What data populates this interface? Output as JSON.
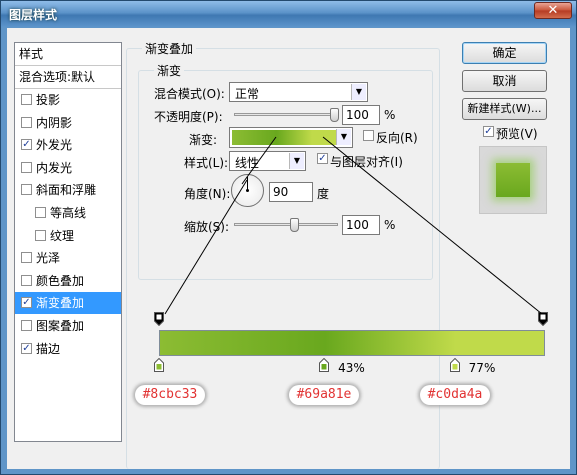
{
  "window": {
    "title": "图层样式",
    "close_glyph": "✕"
  },
  "style_list": {
    "header": "样式",
    "blend_default": "混合选项:默认",
    "items": [
      {
        "label": "投影",
        "checked": false,
        "indent": false,
        "selected": false
      },
      {
        "label": "内阴影",
        "checked": false,
        "indent": false,
        "selected": false
      },
      {
        "label": "外发光",
        "checked": true,
        "indent": false,
        "selected": false
      },
      {
        "label": "内发光",
        "checked": false,
        "indent": false,
        "selected": false
      },
      {
        "label": "斜面和浮雕",
        "checked": false,
        "indent": false,
        "selected": false
      },
      {
        "label": "等高线",
        "checked": false,
        "indent": true,
        "selected": false
      },
      {
        "label": "纹理",
        "checked": false,
        "indent": true,
        "selected": false
      },
      {
        "label": "光泽",
        "checked": false,
        "indent": false,
        "selected": false
      },
      {
        "label": "颜色叠加",
        "checked": false,
        "indent": false,
        "selected": false
      },
      {
        "label": "渐变叠加",
        "checked": true,
        "indent": false,
        "selected": true
      },
      {
        "label": "图案叠加",
        "checked": false,
        "indent": false,
        "selected": false
      },
      {
        "label": "描边",
        "checked": true,
        "indent": false,
        "selected": false
      }
    ]
  },
  "panel": {
    "section_title": "渐变叠加",
    "group_title": "渐变",
    "blend_mode_label": "混合模式(O):",
    "blend_mode_value": "正常",
    "opacity_label": "不透明度(P):",
    "opacity_value": "100",
    "opacity_unit": "%",
    "gradient_label": "渐变:",
    "reverse_label": "反向(R)",
    "reverse_checked": false,
    "style_label": "样式(L):",
    "style_value": "线性",
    "align_label": "与图层对齐(I)",
    "align_checked": true,
    "angle_label": "角度(N):",
    "angle_value": "90",
    "angle_unit": "度",
    "scale_label": "缩放(S):",
    "scale_value": "100",
    "scale_unit": "%"
  },
  "buttons": {
    "ok": "确定",
    "cancel": "取消",
    "new_style": "新建样式(W)...",
    "preview_label": "预览(V)",
    "preview_checked": true
  },
  "gradient_editor": {
    "stops": [
      {
        "color": "#8cbc33",
        "position": 0,
        "label": "#8cbc33",
        "pct": ""
      },
      {
        "color": "#69a81e",
        "position": 43,
        "label": "#69a81e",
        "pct": "43%"
      },
      {
        "color": "#c0da4a",
        "position": 77,
        "label": "#c0da4a",
        "pct": "77%"
      }
    ]
  },
  "colors": {
    "accent_selection": "#3399ff",
    "tag_text": "#e23333"
  }
}
